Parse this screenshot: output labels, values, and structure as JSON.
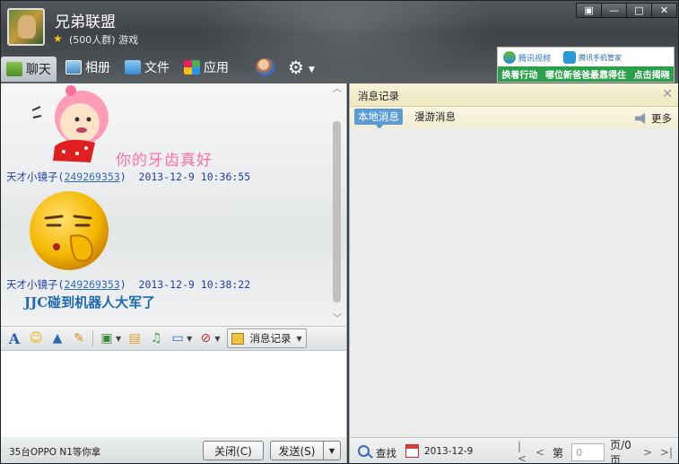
{
  "header": {
    "group_name": "兄弟联盟",
    "group_sub": "(500人群) 游戏",
    "window_buttons": [
      "▣",
      "—",
      "□",
      "✕"
    ]
  },
  "tabs": [
    {
      "label": "聊天",
      "icon": "chat-icon"
    },
    {
      "label": "相册",
      "icon": "photo-icon"
    },
    {
      "label": "文件",
      "icon": "folder-icon"
    },
    {
      "label": "应用",
      "icon": "app-icon"
    }
  ],
  "ad": {
    "brand1": "腾讯视频",
    "brand2": "腾讯手机管家",
    "bottom": [
      "换着行动",
      "哪位新爸爸最靠得住",
      "点击揭晓"
    ]
  },
  "chat": {
    "sticker_caption": "你的牙齿真好",
    "messages": [
      {
        "sender": "天才小镜子",
        "qq": "249269353",
        "time": "2013-12-9 10:36:55"
      },
      {
        "sender": "天才小镜子",
        "qq": "249269353",
        "time": "2013-12-9 10:38:22",
        "text": "JJC碰到机器人大军了"
      }
    ]
  },
  "toolbar": {
    "history_label": "消息记录"
  },
  "bottom": {
    "promo": "35台OPPO N1等你拿",
    "close_label": "关闭(C)",
    "send_label": "发送(S)"
  },
  "history": {
    "title": "消息记录",
    "tab_local": "本地消息",
    "tab_roam": "漫游消息",
    "more": "更多",
    "find": "查找",
    "date": "2013-12-9",
    "page_prefix": "第",
    "page_value": "0",
    "page_suffix": "页/0页"
  },
  "colors": {
    "accent": "#5b9bd5",
    "sender": "#1f3fa8",
    "caption": "#ff6fa8",
    "message": "#1e6ab0"
  }
}
